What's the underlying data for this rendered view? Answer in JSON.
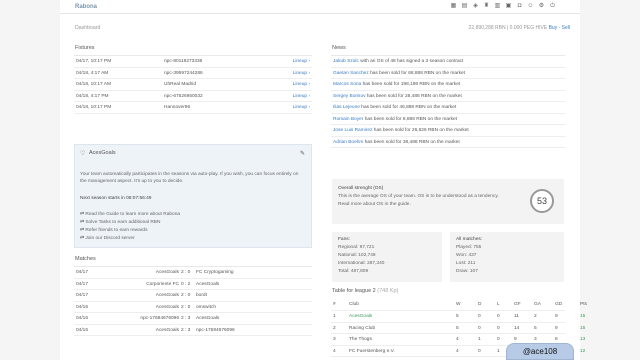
{
  "header": {
    "brand": "Rabona",
    "breadcrumb": "Dashboard",
    "balance": "22,890,288 RBN | 0.000 PEG HIVE",
    "buy_sell": "Buy · Sell"
  },
  "fixtures": {
    "title": "Fixtures",
    "rows": [
      {
        "date": "04/17, 10:17 PM",
        "opponent": "npc-80118273336",
        "action": "Lineup ›"
      },
      {
        "date": "04/18, 4:17 AM",
        "opponent": "npc-39597244286",
        "action": "Lineup ›"
      },
      {
        "date": "04/18, 10:17 AM",
        "opponent": "UhReal Madrid",
        "action": "Lineup ›"
      },
      {
        "date": "04/18, 4:17 PM",
        "opponent": "npc-67526950032",
        "action": "Lineup ›"
      },
      {
        "date": "04/18, 10:17 PM",
        "opponent": "Hannover96",
        "action": "Lineup ›"
      }
    ]
  },
  "aces": {
    "title": "AcesGoals",
    "desc": "Your team automatically participates in the seasons via auto-play. If you wish, you can focus entirely on the management aspect. It's up to you to decide.",
    "next_season": "Next season starts in 08:07:56:49",
    "links": [
      "Read the Guide to learn more about Rabona",
      "Solve Tasks to earn additional RBN",
      "Refer friends to earn rewards",
      "Join our Discord server"
    ]
  },
  "matches": {
    "title": "Matches",
    "rows": [
      {
        "date": "04/17",
        "home": "AcesGoals",
        "score": "2 : 0",
        "away": "FC Cryptogaming"
      },
      {
        "date": "04/17",
        "home": "Corporiente FC",
        "score": "0 : 2",
        "away": "AcesGoals"
      },
      {
        "date": "04/17",
        "home": "AcesGoals",
        "score": "2 : 0",
        "away": "bordt"
      },
      {
        "date": "04/16",
        "home": "AcesGoals",
        "score": "2 : 0",
        "away": "omswitch"
      },
      {
        "date": "04/16",
        "home": "npc-17684676096",
        "score": "2 : 3",
        "away": "AcesGoals"
      },
      {
        "date": "04/16",
        "home": "AcesGoals",
        "score": "2 : 3",
        "away": "npc-17684676096"
      }
    ]
  },
  "news": {
    "title": "News",
    "items": [
      {
        "name": "Jakub Szulc",
        "text": " with an OS of 48 has signed a 3 season contract"
      },
      {
        "name": "Gaetan Sanchez",
        "text": " has been sold for 68,888 RBN on the market"
      },
      {
        "name": "Marcos Soria",
        "text": " has been sold for 198,198 RBN on the market"
      },
      {
        "name": "Sergey Borisov",
        "text": " has been sold for 28,488 RBN on the market"
      },
      {
        "name": "Ilias Lejeune",
        "text": " has been sold for 46,888 RBN on the market"
      },
      {
        "name": "Romain Boyer",
        "text": " has been sold for 8,888 RBN on the market"
      },
      {
        "name": "Jose Luis Ramirez",
        "text": " has been sold for 26,626 RBN on the market"
      },
      {
        "name": "Adrian Boehm",
        "text": " has been sold for 38,488 RBN on the market"
      }
    ]
  },
  "strength": {
    "title": "Overall strenght (OS)",
    "line1": "This is the average OS of your team. OS is to be understood as a tendency.",
    "line2": "Read more about OS in the guide.",
    "value": "53"
  },
  "fans": {
    "title": "Fans:",
    "regional": "Regional: 97,721",
    "national": "National: 102,748",
    "international": "International: 287,340",
    "total": "Total: 487,809"
  },
  "all_matches": {
    "title": "All matches:",
    "played": "Played: 755",
    "won": "Won: 437",
    "lost": "Lost: 211",
    "draw": "Draw: 107"
  },
  "league": {
    "title": "Table for league 2",
    "subtitle": "(748 Kp)",
    "headers": [
      "#",
      "Club",
      "W",
      "D",
      "L",
      "GF",
      "GA",
      "GD",
      "Pts"
    ],
    "rows": [
      [
        "1",
        "AcesGoals",
        "5",
        "0",
        "0",
        "11",
        "2",
        "9",
        "15"
      ],
      [
        "2",
        "Racing Club",
        "5",
        "0",
        "0",
        "14",
        "5",
        "9",
        "15"
      ],
      [
        "3",
        "The Thogs",
        "4",
        "1",
        "0",
        "9",
        "3",
        "6",
        "13"
      ],
      [
        "4",
        "FC Fuerstenberg e.V.",
        "4",
        "0",
        "1",
        "8",
        "5",
        "3",
        "12"
      ]
    ]
  },
  "watermark": "@ace108"
}
